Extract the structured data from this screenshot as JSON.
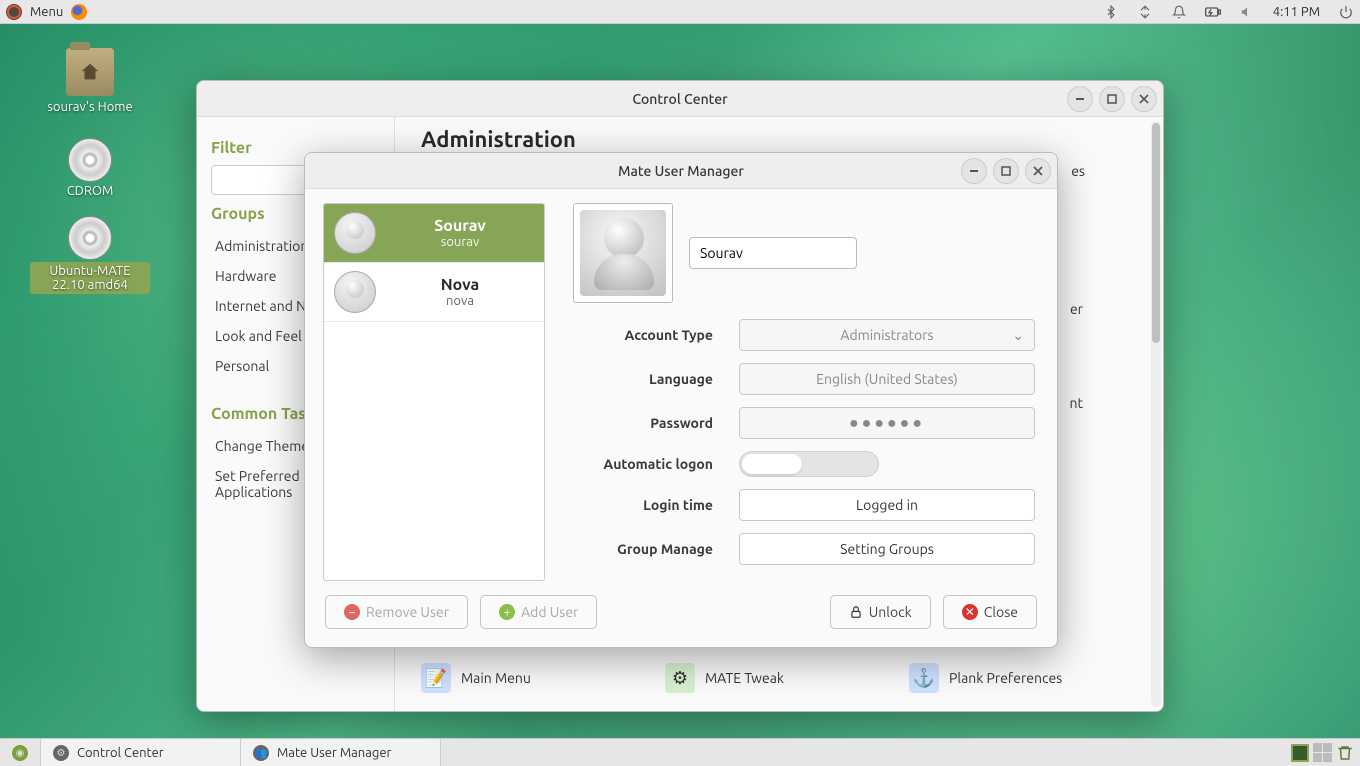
{
  "panel": {
    "menu_label": "Menu",
    "clock": "4:11 PM"
  },
  "desktop": {
    "home": "sourav's Home",
    "cdrom": "CDROM",
    "iso": "Ubuntu-MATE 22.10 amd64"
  },
  "cc": {
    "title": "Control Center",
    "filter_heading": "Filter",
    "groups_heading": "Groups",
    "common_heading": "Common Tasks",
    "search_placeholder": "",
    "groups": [
      "Administration",
      "Hardware",
      "Internet and Network",
      "Look and Feel",
      "Personal"
    ],
    "tasks": [
      "Change Theme",
      "Set Preferred Applications"
    ],
    "section_title": "Administration",
    "visible_items": {
      "a": "es",
      "b": "er",
      "c": "nt",
      "main_menu": "Main Menu",
      "mate_tweak": "MATE Tweak",
      "plank": "Plank Preferences"
    }
  },
  "um": {
    "title": "Mate User Manager",
    "users": [
      {
        "display": "Sourav",
        "login": "sourav",
        "selected": true
      },
      {
        "display": "Nova",
        "login": "nova",
        "selected": false
      }
    ],
    "name_value": "Sourav",
    "labels": {
      "account_type": "Account Type",
      "language": "Language",
      "password": "Password",
      "auto_logon": "Automatic logon",
      "login_time": "Login time",
      "group_manage": "Group Manage"
    },
    "values": {
      "account_type": "Administrators",
      "language": "English (United States)",
      "password": "●●●●●●",
      "login_time": "Logged in",
      "group_manage": "Setting Groups"
    },
    "buttons": {
      "remove": "Remove User",
      "add": "Add User",
      "unlock": "Unlock",
      "close": "Close"
    }
  },
  "bottom": {
    "task_cc": "Control Center",
    "task_um": "Mate User Manager"
  }
}
